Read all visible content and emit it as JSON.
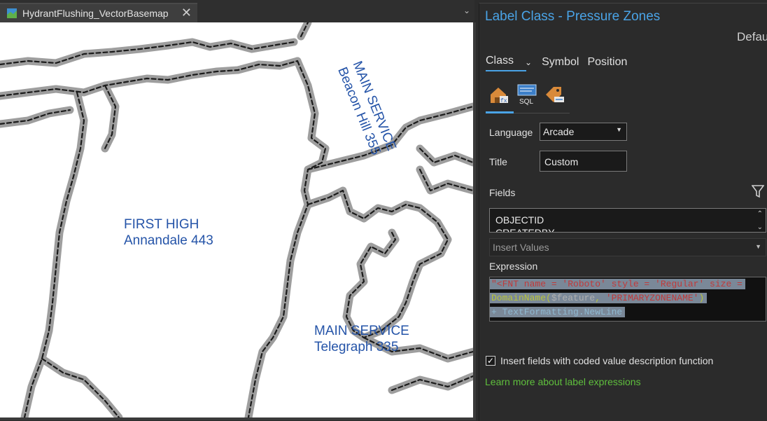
{
  "map_tab": {
    "title": "HydrantFlushing_VectorBasemap",
    "close_glyph": "✕",
    "overflow_glyph": "⌄"
  },
  "map": {
    "labels": {
      "main_service_vertical": {
        "line1": "MAIN SERVICE",
        "line2": "Beacon Hill 355"
      },
      "first_high": {
        "line1": "FIRST HIGH",
        "line2": "Annandale 443"
      },
      "main_service_telegraph": {
        "line1": "MAIN SERVICE",
        "line2": "Telegraph 335"
      }
    },
    "label_color": "#2554a8"
  },
  "panel": {
    "title": "Label Class - Pressure Zones",
    "default_text": "Defau",
    "tabs": {
      "class": "Class",
      "class_chevron": "⌄",
      "symbol": "Symbol",
      "position": "Position"
    },
    "language": {
      "label": "Language",
      "value": "Arcade",
      "arrow": "▼"
    },
    "title_field": {
      "label": "Title",
      "value": "Custom"
    },
    "fields": {
      "label": "Fields",
      "items": [
        "OBJECTID",
        "CREATEDBY"
      ],
      "scroll_up": "⌃",
      "scroll_down": "⌄"
    },
    "insert_values": {
      "placeholder": "Insert Values",
      "arrow": "▼"
    },
    "expression": {
      "label": "Expression",
      "line1": "\"<FNT name = 'Roboto' style = 'Regular' size =",
      "line2_fn": "DomainName(",
      "line2_var": "$feature",
      "line2_sep": ", ",
      "line2_str": "'PRIMARYZONENAME'",
      "line2_end": ")",
      "line3": "+ TextFormatting.NewLine"
    },
    "checkbox": {
      "checked_glyph": "✓",
      "label": "Insert fields with coded value description function"
    },
    "learn_more": "Learn more about label expressions",
    "accent_color": "#4aa3e6",
    "link_color": "#5fbf3d"
  }
}
